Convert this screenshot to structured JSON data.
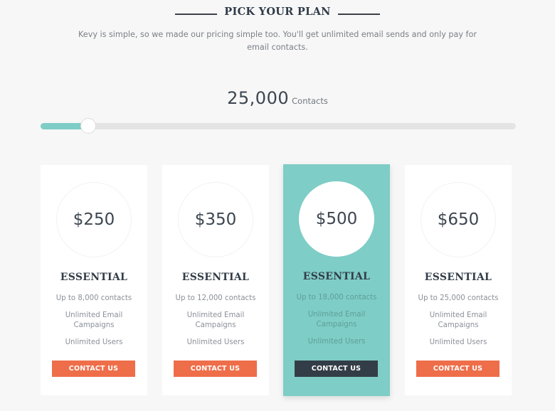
{
  "header": {
    "title": "PICK YOUR PLAN",
    "subtitle": "Kevy is simple, so we made our pricing simple too. You'll get unlimited email sends and only pay for email contacts."
  },
  "contacts": {
    "value": "25,000",
    "unit": "Contacts",
    "slider_fraction": 0.1
  },
  "colors": {
    "accent_teal": "#7ecdc6",
    "button_orange": "#ee6e4a",
    "button_dark": "#333d47",
    "background": "#f7f7f7"
  },
  "plans": [
    {
      "price": "$250",
      "name": "ESSENTIAL",
      "features": [
        "Up to 8,000 contacts",
        "Unlimited Email Campaigns",
        "Unlimited Users"
      ],
      "button": "CONTACT US",
      "featured": false
    },
    {
      "price": "$350",
      "name": "ESSENTIAL",
      "features": [
        "Up to 12,000 contacts",
        "Unlimited Email Campaigns",
        "Unlimited Users"
      ],
      "button": "CONTACT US",
      "featured": false
    },
    {
      "price": "$500",
      "name": "ESSENTIAL",
      "features": [
        "Up to 18,000 contacts",
        "Unlimited Email Campaigns",
        "Unlimited Users"
      ],
      "button": "CONTACT US",
      "featured": true
    },
    {
      "price": "$650",
      "name": "ESSENTIAL",
      "features": [
        "Up to 25,000 contacts",
        "Unlimited Email Campaigns",
        "Unlimited Users"
      ],
      "button": "CONTACT US",
      "featured": false
    }
  ]
}
